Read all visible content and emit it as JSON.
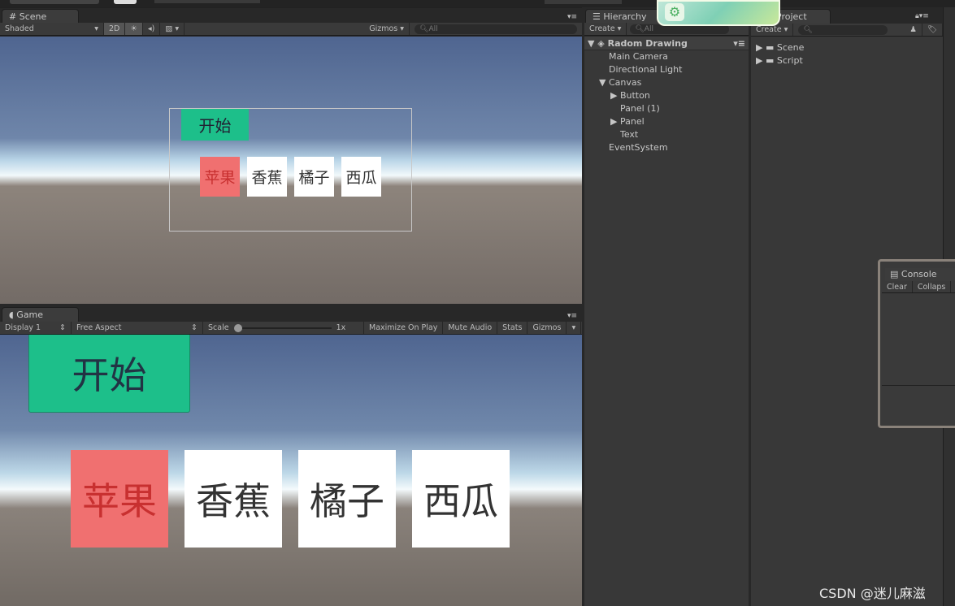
{
  "scene": {
    "tab": "Scene",
    "shading": "Shaded",
    "mode2d": "2D",
    "gizmos": "Gizmos ▾",
    "search_placeholder": "All",
    "start_button": "开始",
    "fruits": [
      "苹果",
      "香蕉",
      "橘子",
      "西瓜"
    ]
  },
  "game": {
    "tab": "Game",
    "display": "Display 1",
    "aspect": "Free Aspect",
    "scale_label": "Scale",
    "scale_value": "1x",
    "maximize": "Maximize On Play",
    "mute": "Mute Audio",
    "stats": "Stats",
    "gizmos": "Gizmos",
    "start_button": "开始",
    "fruits": [
      "苹果",
      "香蕉",
      "橘子",
      "西瓜"
    ]
  },
  "hierarchy": {
    "tab": "Hierarchy",
    "create": "Create ▾",
    "search_placeholder": "All",
    "scene_name": "Radom Drawing",
    "items": [
      {
        "label": "Main Camera"
      },
      {
        "label": "Directional Light"
      },
      {
        "label": "Canvas"
      },
      {
        "label": "Button"
      },
      {
        "label": "Panel (1)"
      },
      {
        "label": "Panel"
      },
      {
        "label": "Text"
      },
      {
        "label": "EventSystem"
      }
    ]
  },
  "project": {
    "tab": "Project",
    "create": "Create ▾",
    "folders": [
      "Scene",
      "Script"
    ]
  },
  "console": {
    "title": "Console",
    "clear": "Clear",
    "collapse": "Collaps"
  },
  "watermark": "CSDN @迷儿麻滋",
  "colors": {
    "start_green": "#1dbf8a",
    "selected_red": "#f07070",
    "selected_text": "#c83030"
  }
}
